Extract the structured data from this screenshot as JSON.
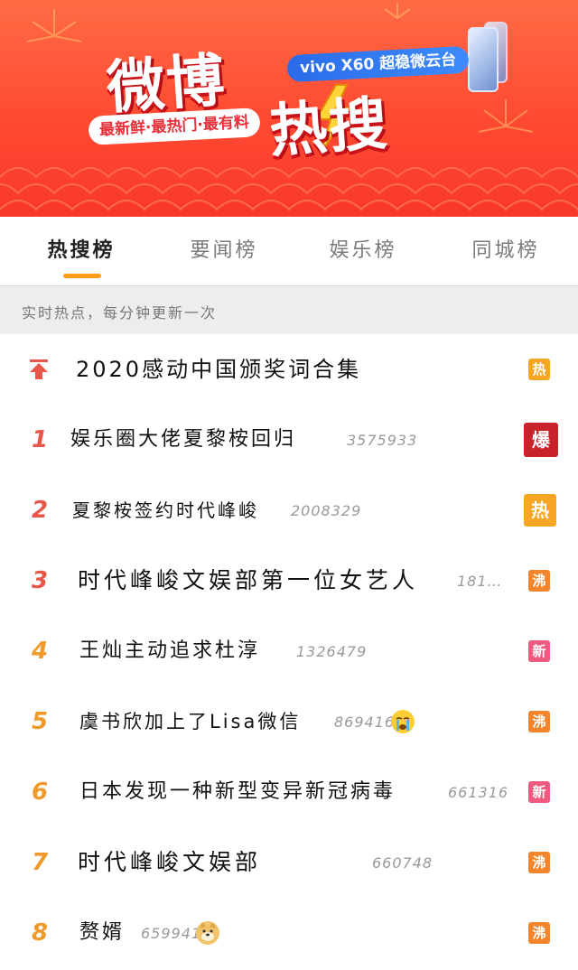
{
  "banner": {
    "logo_line1": "微博",
    "logo_line2": "热搜",
    "sponsor": "vivo X60 超稳微云台",
    "slogan": "最新鲜·最热门·最有料"
  },
  "tabs": [
    {
      "label": "热搜榜",
      "active": true
    },
    {
      "label": "要闻榜",
      "active": false
    },
    {
      "label": "娱乐榜",
      "active": false
    },
    {
      "label": "同城榜",
      "active": false
    }
  ],
  "info_bar": "实时热点，每分钟更新一次",
  "colors": {
    "accent_orange": "#ff9c1a",
    "rank_top": "#e8574a",
    "rank_mid": "#f09a2b",
    "badge_bao": "#c8222b",
    "badge_re": "#f6a623",
    "badge_fei": "#f5852c",
    "badge_xin": "#f05a7e"
  },
  "rows": [
    {
      "rank": "",
      "rank_icon": "pinned-arrow-icon",
      "title": "2020感动中国颁奖词合集",
      "count": "",
      "badge": "热",
      "badge_color": "#f6a623",
      "emoji": ""
    },
    {
      "rank": "1",
      "title": "娱乐圈大佬夏黎桉回归",
      "count": "3575933",
      "badge": "爆",
      "badge_color": "#c8222b",
      "emoji": ""
    },
    {
      "rank": "2",
      "title": "夏黎桉签约时代峰峻",
      "count": "2008329",
      "badge": "热",
      "badge_color": "#f6a623",
      "emoji": ""
    },
    {
      "rank": "3",
      "title": "时代峰峻文娱部第一位女艺人",
      "count": "181…",
      "badge": "沸",
      "badge_color": "#f5852c",
      "emoji": ""
    },
    {
      "rank": "4",
      "title": "王灿主动追求杜淳",
      "count": "1326479",
      "badge": "新",
      "badge_color": "#f05a7e",
      "emoji": ""
    },
    {
      "rank": "5",
      "title": "虞书欣加上了Lisa微信",
      "count": "869416",
      "badge": "沸",
      "badge_color": "#f5852c",
      "emoji": "crying-face-emoji"
    },
    {
      "rank": "6",
      "title": "日本发现一种新型变异新冠病毒",
      "count": "661316",
      "badge": "新",
      "badge_color": "#f05a7e",
      "emoji": ""
    },
    {
      "rank": "7",
      "title": "时代峰峻文娱部",
      "count": "660748",
      "badge": "沸",
      "badge_color": "#f5852c",
      "emoji": ""
    },
    {
      "rank": "8",
      "title": "赘婿",
      "count": "659941",
      "badge": "沸",
      "badge_color": "#f5852c",
      "emoji": "doge-emoji"
    }
  ]
}
